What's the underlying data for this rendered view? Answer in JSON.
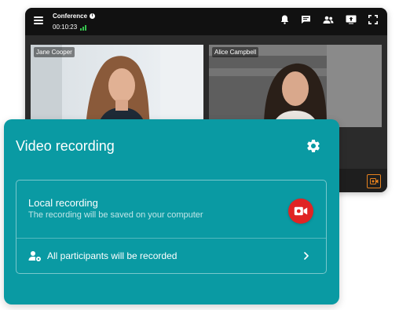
{
  "conference": {
    "title": "Conference",
    "timer": "00:10:23",
    "participants": [
      {
        "name": "Jane Cooper"
      },
      {
        "name": "Alice Campbell"
      }
    ]
  },
  "recording_panel": {
    "title": "Video recording",
    "local_recording": {
      "title": "Local recording",
      "subtitle": "The recording will be saved on your computer"
    },
    "participants_row": {
      "label": "All participants will be recorded"
    }
  },
  "colors": {
    "panel": "#0a9aa3",
    "record_button": "#e02424",
    "signal": "#35c14d",
    "record_small": "#e8821e"
  },
  "icons": {
    "top_bar": [
      "bell-icon",
      "chat-icon",
      "participants-icon",
      "screen-share-icon",
      "fullscreen-icon"
    ],
    "panel": [
      "gear-icon",
      "video-record-icon",
      "participant-settings-icon",
      "chevron-right-icon"
    ]
  }
}
